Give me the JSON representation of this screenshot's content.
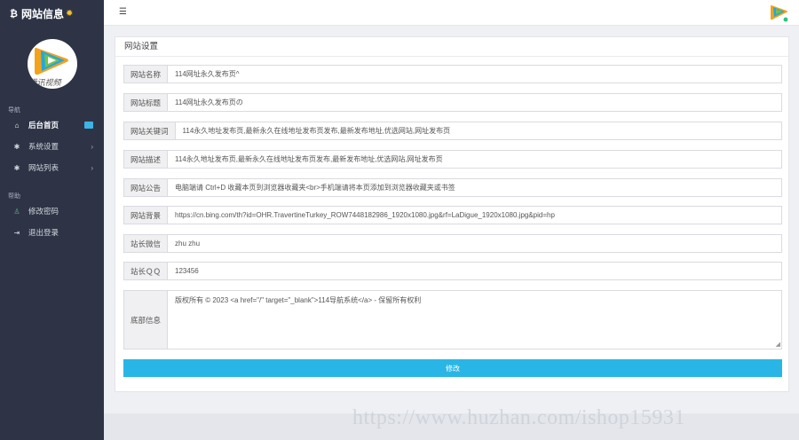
{
  "sidebar": {
    "brand_title": "网站信息",
    "avatar_text": "腾讯视频",
    "nav_section_title": "导航",
    "nav_items": [
      {
        "label": "后台首页",
        "icon": "home-icon"
      },
      {
        "label": "系统设置",
        "icon": "gear-icon"
      },
      {
        "label": "网站列表",
        "icon": "gear-icon"
      }
    ],
    "help_section_title": "帮助",
    "help_items": [
      {
        "label": "修改密码",
        "icon": "user-icon"
      },
      {
        "label": "退出登录",
        "icon": "logout-icon"
      }
    ]
  },
  "header": {
    "menu_icon": "hamburger-icon",
    "logo_icon": "tencent-video-logo"
  },
  "panel": {
    "title": "网站设置",
    "fields": [
      {
        "label": "网站名称",
        "value": "114网址永久发布页^"
      },
      {
        "label": "网站标题",
        "value": "114网址永久发布页の"
      },
      {
        "label": "网站关键词",
        "value": "114永久地址发布页,最新永久在线地址发布页发布,最新发布地址,优选网站,网址发布页"
      },
      {
        "label": "网站描述",
        "value": "114永久地址发布页,最新永久在线地址发布页发布,最新发布地址,优选网站,网址发布页"
      },
      {
        "label": "网站公告",
        "value": "电脑端请 Ctrl+D 收藏本页到浏览器收藏夹<br>手机端请将本页添加到浏览器收藏夹或书签"
      },
      {
        "label": "网站背景",
        "value": "https://cn.bing.com/th?id=OHR.TravertineTurkey_ROW7448182986_1920x1080.jpg&rf=LaDigue_1920x1080.jpg&pid=hp"
      },
      {
        "label": "站长微信",
        "value": "zhu zhu"
      },
      {
        "label": "站长ＱＱ",
        "value": "123456"
      }
    ],
    "footer_label": "底部信息",
    "footer_value": "版权所有 © 2023 <a href=\"/\" target=\"_blank\">114导航系统</a> - 保留所有权利",
    "submit_label": "修改"
  },
  "watermark": "https://www.huzhan.com/ishop15931",
  "colors": {
    "sidebar": "#2e3446",
    "accent": "#29b6e6",
    "brand_sun": "#f2c12e"
  }
}
